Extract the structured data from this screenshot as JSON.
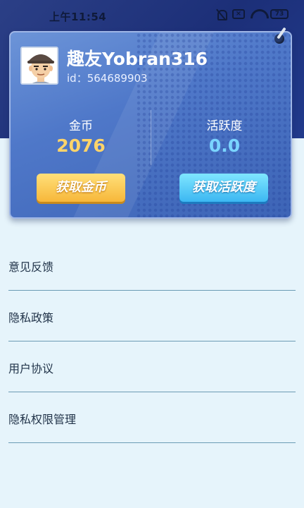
{
  "status_bar": {
    "time": "上午11:54",
    "battery": "73",
    "icons": [
      "mute-icon",
      "sim-off-icon",
      "wifi-icon",
      "battery-icon"
    ]
  },
  "profile": {
    "name": "趣友Yobran316",
    "id_text": "id：564689903",
    "avatar_icon": "user-avatar-icon"
  },
  "stats": {
    "coins_label": "金币",
    "coins_value": "2076",
    "activity_label": "活跃度",
    "activity_value": "0.0"
  },
  "buttons": {
    "get_coins": "获取金币",
    "get_activity": "获取活跃度"
  },
  "menu": {
    "items": [
      {
        "label": "意见反馈"
      },
      {
        "label": "隐私政策"
      },
      {
        "label": "用户协议"
      },
      {
        "label": "隐私权限管理"
      }
    ]
  },
  "colors": {
    "header_bg": "#213a8c",
    "card_bg": "#4f78c9",
    "coins_value": "#ffd46a",
    "activity_value": "#7ad4ff",
    "page_bg": "#e6f4fb",
    "divider": "#6b9bb4"
  }
}
